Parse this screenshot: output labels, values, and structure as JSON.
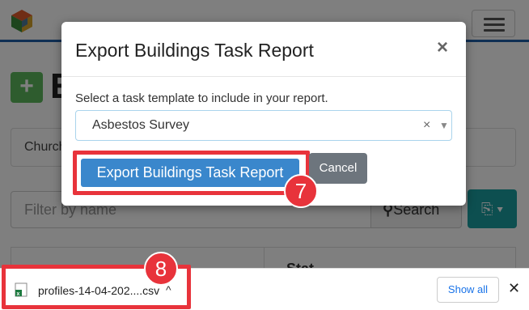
{
  "background": {
    "heading_initial": "E",
    "add_symbol": "+",
    "tab_label": "Church",
    "filter_placeholder": "Filter by name",
    "search_label": "Search",
    "table_header": "Stat"
  },
  "modal": {
    "title": "Export Buildings Task Report",
    "close_symbol": "×",
    "label": "Select a task template to include in your report.",
    "selected_value": "Asbestos Survey",
    "clear_symbol": "×",
    "arrow_symbol": "▼",
    "primary_button": "Export Buildings Task Report",
    "cancel_button": "Cancel"
  },
  "annotations": {
    "step_7": "7",
    "step_8": "8"
  },
  "download_bar": {
    "filename": "profiles-14-04-202....csv",
    "chevron": "^",
    "show_all": "Show all",
    "close_symbol": "✕"
  },
  "colors": {
    "primary": "#3a87cc",
    "annotation_red": "#e8333b",
    "teal": "#1a9ea0",
    "green": "#5cb85c"
  },
  "icons": {
    "logo": "logo-icon",
    "hamburger": "hamburger-menu-icon",
    "search": "search-icon",
    "export": "export-file-icon",
    "excel": "excel-file-icon"
  }
}
